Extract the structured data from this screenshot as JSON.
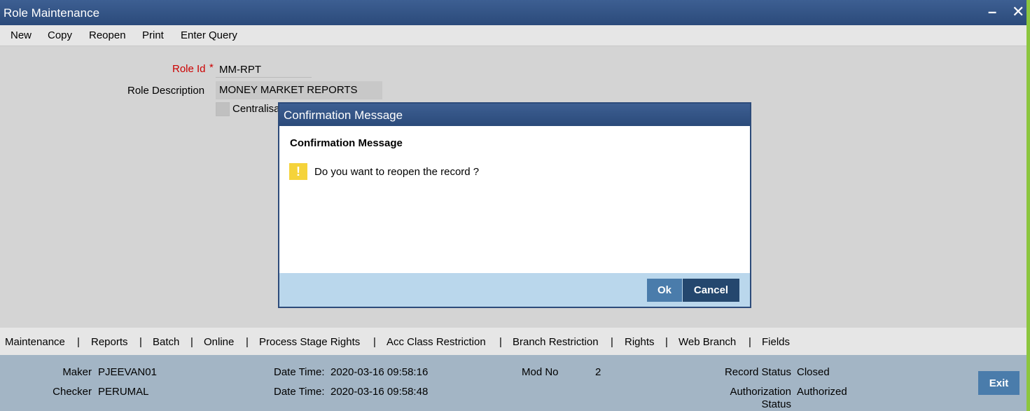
{
  "window": {
    "title": "Role Maintenance",
    "minimize_glyph": "–",
    "close_glyph": "✕"
  },
  "toolbar": {
    "items": [
      "New",
      "Copy",
      "Reopen",
      "Print",
      "Enter Query"
    ]
  },
  "form": {
    "role_id_label": "Role Id",
    "required_marker": "*",
    "role_id_value": "MM-RPT",
    "role_description_label": "Role Description",
    "role_description_value": "MONEY MARKET REPORTS",
    "centralisation_label_partial": "Centralisa"
  },
  "dialog": {
    "title": "Confirmation Message",
    "heading": "Confirmation Message",
    "icon": "warning-icon",
    "icon_glyph": "!",
    "message": "Do you want to reopen the record ?",
    "ok_label": "Ok",
    "cancel_label": "Cancel"
  },
  "tabs": [
    "Maintenance",
    "Reports",
    "Batch",
    "Online",
    "Process Stage Rights",
    "Acc Class Restriction",
    "Branch Restriction",
    "Rights",
    "Web Branch",
    "Fields"
  ],
  "tab_separator": "|",
  "footer": {
    "maker_label": "Maker",
    "maker_value": "PJEEVAN01",
    "checker_label": "Checker",
    "checker_value": "PERUMAL",
    "maker_datetime_label": "Date Time:",
    "maker_datetime_value": "2020-03-16 09:58:16",
    "checker_datetime_label": "Date Time:",
    "checker_datetime_value": "2020-03-16 09:58:48",
    "mod_no_label": "Mod No",
    "mod_no_value": "2",
    "record_status_label": "Record Status",
    "record_status_value": "Closed",
    "auth_status_label_line1": "Authorization",
    "auth_status_label_line2": "Status",
    "auth_status_value": "Authorized",
    "exit_label": "Exit"
  },
  "colors": {
    "titlebar": "#2b4a7a",
    "accent_green": "#8cc63f",
    "button_primary": "#4a7cab",
    "button_dark": "#24476e",
    "warning": "#f5d33a",
    "required": "#cc0000"
  }
}
